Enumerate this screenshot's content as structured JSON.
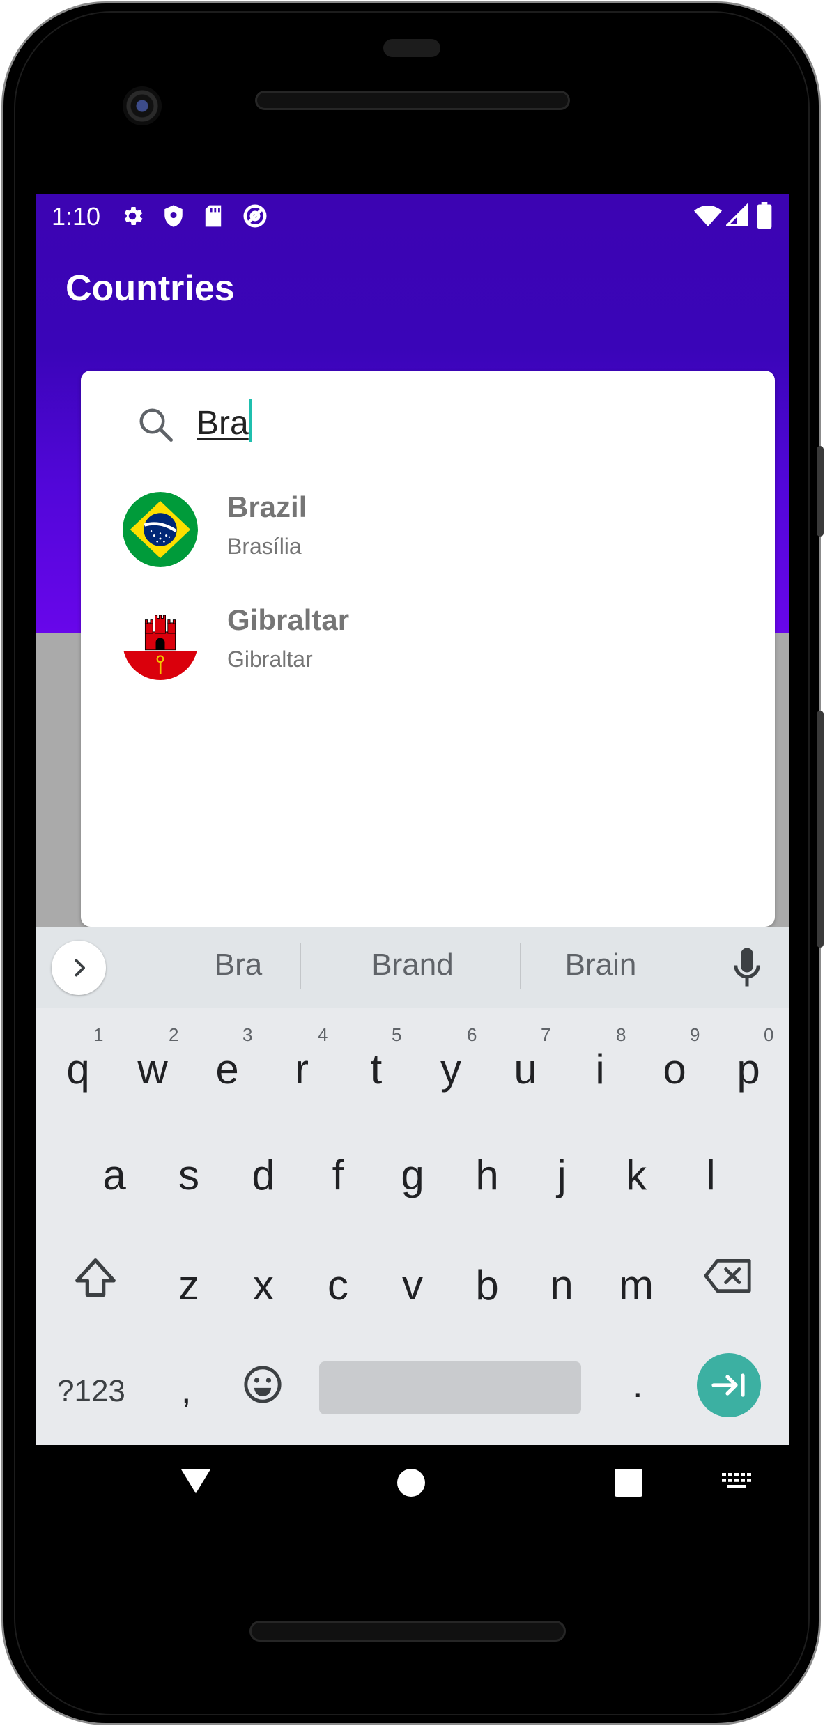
{
  "status_bar": {
    "time": "1:10",
    "left_icons": [
      "settings-icon",
      "shield-icon",
      "sd-card-icon",
      "at-sign-icon"
    ],
    "right_icons": [
      "wifi-icon",
      "signal-icon",
      "battery-icon"
    ]
  },
  "app_bar": {
    "title": "Countries"
  },
  "search": {
    "value": "Bra",
    "icon": "search-icon"
  },
  "results": [
    {
      "name": "Brazil",
      "capital": "Brasília",
      "flag": "brazil-flag-icon"
    },
    {
      "name": "Gibraltar",
      "capital": "Gibraltar",
      "flag": "gibraltar-flag-icon"
    }
  ],
  "keyboard": {
    "suggestions": [
      "Bra",
      "Brand",
      "Brain"
    ],
    "row1": [
      "q",
      "w",
      "e",
      "r",
      "t",
      "y",
      "u",
      "i",
      "o",
      "p"
    ],
    "row1_hints": [
      "1",
      "2",
      "3",
      "4",
      "5",
      "6",
      "7",
      "8",
      "9",
      "0"
    ],
    "row2": [
      "a",
      "s",
      "d",
      "f",
      "g",
      "h",
      "j",
      "k",
      "l"
    ],
    "row3": [
      "z",
      "x",
      "c",
      "v",
      "b",
      "n",
      "m"
    ],
    "symbols_label": "?123",
    "comma": ",",
    "period": "."
  },
  "nav_bar": {
    "icons": [
      "back-icon",
      "home-icon",
      "recents-icon",
      "keyboard-switch-icon"
    ]
  },
  "colors": {
    "app_bar_top": "#3c04b2",
    "app_bar_bottom": "#6806ea",
    "caret": "#1fbfae",
    "enter_key": "#3cb0a2",
    "brazil_green": "#009b3a",
    "brazil_yellow": "#fedf00",
    "brazil_blue": "#002776",
    "gibraltar_red": "#da000c"
  }
}
